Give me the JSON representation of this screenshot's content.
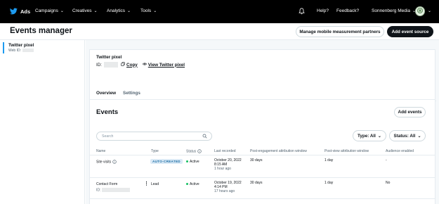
{
  "topnav": {
    "brand": "Ads",
    "menu": [
      {
        "label": "Campaigns"
      },
      {
        "label": "Creatives"
      },
      {
        "label": "Analytics"
      },
      {
        "label": "Tools"
      }
    ],
    "help": "Help?",
    "feedback": "Feedback?",
    "account": "Sonnenberg Media",
    "icons": {
      "brand": "bird-logo-icon",
      "notifications": "bell-icon",
      "avatar": "avatar-icon"
    }
  },
  "header": {
    "title": "Events manager",
    "manage_button": "Manage mobile measurement partners",
    "add_source_button": "Add event source"
  },
  "sidebar": {
    "items": [
      {
        "title": "Twitter pixel",
        "subtitle": "Web ID:"
      }
    ]
  },
  "pixel": {
    "name": "Twitter pixel",
    "id_label": "ID:",
    "copy_label": "Copy",
    "view_label": "View Twitter pixel"
  },
  "tabs": [
    {
      "label": "Overview",
      "active": true
    },
    {
      "label": "Settings",
      "active": false
    }
  ],
  "events": {
    "title": "Events",
    "add_button": "Add events",
    "search_placeholder": "Search",
    "filter_type": "Type: All",
    "filter_status": "Status: All",
    "columns": [
      "Name",
      "Type",
      "Status",
      "Last recorded",
      "Post-engagement attribution window",
      "Post-view attribution window",
      "Audience enabled"
    ],
    "rows": [
      {
        "name": "Site visits",
        "type": "AUTO-CREATED",
        "status": "Active",
        "last_recorded_date": "October 20, 2022",
        "last_recorded_time": "8:15 AM",
        "last_recorded_ago": "1 hour ago",
        "post_engagement": "30 days",
        "post_view": "1 day",
        "audience": "-"
      },
      {
        "name": "Contact Form",
        "id_label": "ID:",
        "type": "Lead",
        "status": "Active",
        "last_recorded_date": "October 19, 2022",
        "last_recorded_time": "4:14 PM",
        "last_recorded_ago": "17 hours ago",
        "post_engagement": "30 days",
        "post_view": "1 day",
        "audience": "No"
      }
    ]
  },
  "colors": {
    "accent": "#1d9bf0",
    "active_status": "#17bf63",
    "badge_bg": "#dbeaf6"
  }
}
